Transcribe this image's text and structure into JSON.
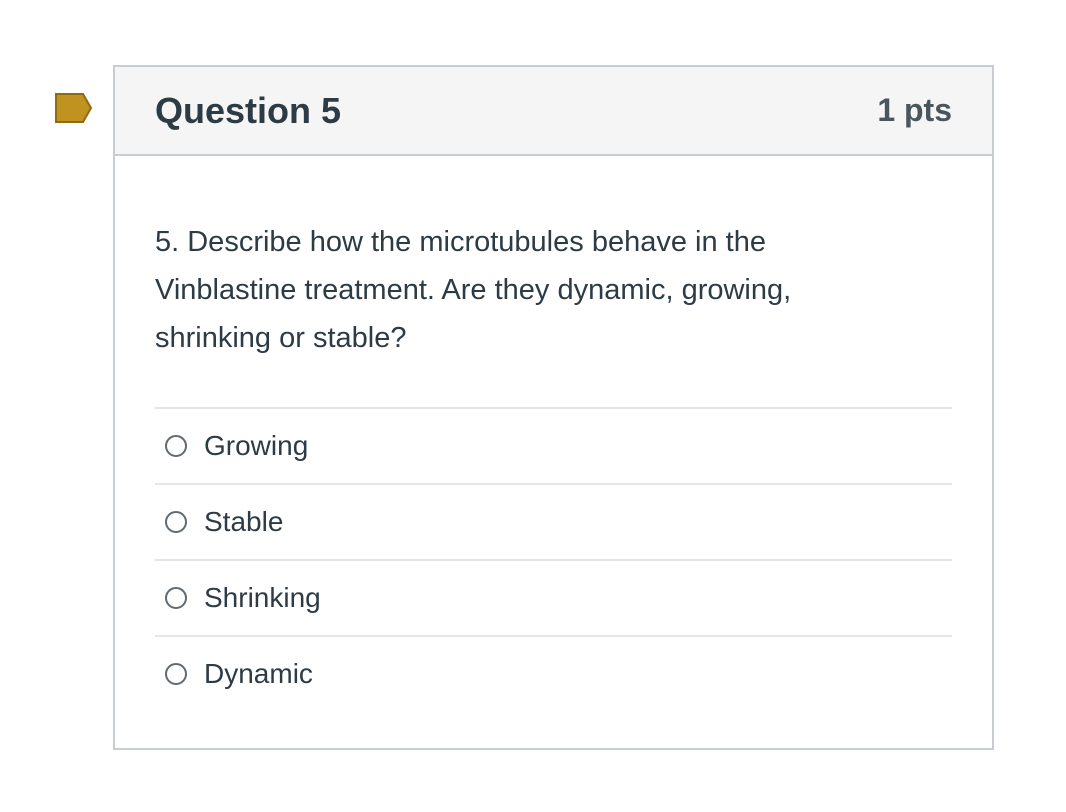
{
  "colors": {
    "flag_fill": "#c0921f",
    "header_bg": "#f5f5f5",
    "border": "#c7cdd1",
    "text": "#2d3b45"
  },
  "flag": {
    "icon": "bookmark-flag-icon"
  },
  "question": {
    "title": "Question 5",
    "points": "1 pts",
    "text": "5. Describe how the microtubules behave in the Vinblastine treatment. Are they dynamic, growing, shrinking or stable?"
  },
  "answers": [
    {
      "label": "Growing",
      "selected": false
    },
    {
      "label": "Stable",
      "selected": false
    },
    {
      "label": "Shrinking",
      "selected": false
    },
    {
      "label": "Dynamic",
      "selected": false
    }
  ]
}
